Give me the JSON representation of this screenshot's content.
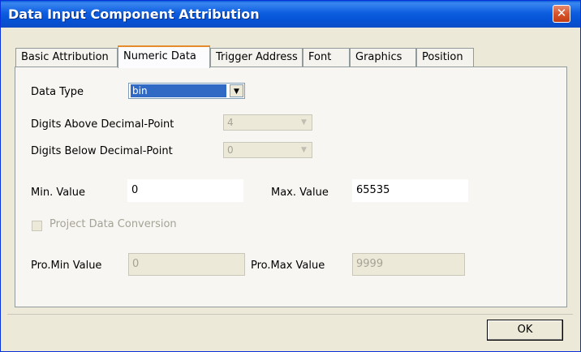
{
  "window": {
    "title": "Data Input Component Attribution"
  },
  "tabs": [
    {
      "label": "Basic Attribution"
    },
    {
      "label": "Numeric Data"
    },
    {
      "label": "Trigger Address"
    },
    {
      "label": "Font"
    },
    {
      "label": "Graphics"
    },
    {
      "label": "Position"
    }
  ],
  "active_tab": "Numeric Data",
  "form": {
    "data_type_label": "Data Type",
    "data_type_value": "bin",
    "digits_above_label": "Digits Above Decimal-Point",
    "digits_above_value": "4",
    "digits_below_label": "Digits Below Decimal-Point",
    "digits_below_value": "0",
    "min_label": "Min. Value",
    "min_value": "0",
    "max_label": "Max. Value",
    "max_value": "65535",
    "project_conversion_label": "Project Data Conversion",
    "project_conversion_checked": false,
    "pro_min_label": "Pro.Min Value",
    "pro_min_value": "0",
    "pro_max_label": "Pro.Max Value",
    "pro_max_value": "9999"
  },
  "buttons": {
    "ok_label": "OK"
  },
  "icons": {
    "close": "close-icon",
    "dropdown": "chevron-down-icon"
  }
}
